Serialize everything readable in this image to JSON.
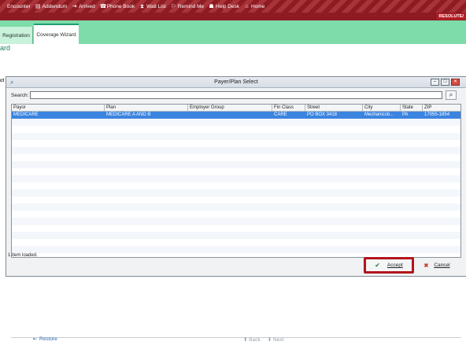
{
  "toolbar": {
    "items": [
      {
        "label": "Encounter",
        "icon": "encounter-icon",
        "glyph": ""
      },
      {
        "label": "Addendum",
        "icon": "addendum-icon",
        "glyph": "▤"
      },
      {
        "label": "Arrived",
        "icon": "arrived-icon",
        "glyph": "⇥"
      },
      {
        "label": "Phone Book",
        "icon": "phone-book-icon",
        "glyph": "☎"
      },
      {
        "label": "Wait List",
        "icon": "wait-list-icon",
        "glyph": "⧗"
      },
      {
        "label": "Remind Me",
        "icon": "remind-me-icon",
        "glyph": "⚐"
      },
      {
        "label": "Help Desk",
        "icon": "help-desk-icon",
        "glyph": "☗"
      },
      {
        "label": "Home",
        "icon": "home-icon",
        "glyph": "⌂"
      }
    ],
    "badge": "RESOLUTE/"
  },
  "tabs": [
    {
      "label": "Registration"
    },
    {
      "label": "Coverage Wizard"
    }
  ],
  "page_title": "ard",
  "left_stub": "ct",
  "dialog": {
    "title": "Payer/Plan Select",
    "search_label": "Search:",
    "search_value": "",
    "columns": [
      "Payor",
      "Plan",
      "Employer Group",
      "Fin Class",
      "Street",
      "City",
      "State",
      "ZIP"
    ],
    "rows": [
      [
        "MEDICARE",
        "MEDICARE A AND B",
        "",
        "CARE",
        "PO BOX 3418",
        "Mechanicsb...",
        "PA",
        "17055-1854"
      ]
    ],
    "status": "1 item loaded.",
    "accept_label": "Accept",
    "cancel_label": "Cancel",
    "colors": {
      "selected_row": "#3b84e0",
      "accept_highlight": "#b3151d"
    }
  },
  "footer": {
    "restore_label": "Restore",
    "back_label": "Back",
    "next_label": "Next"
  }
}
